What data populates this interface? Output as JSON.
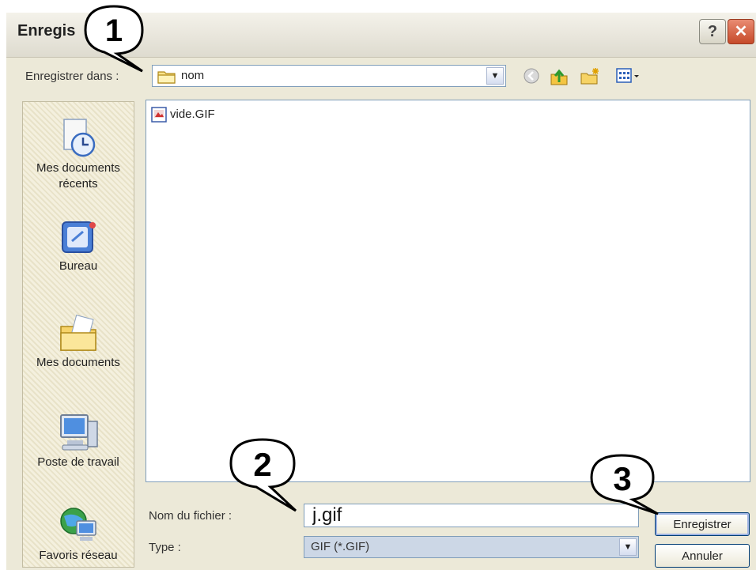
{
  "dialog": {
    "title": "Enregis",
    "help_glyph": "?",
    "close_glyph": "✕"
  },
  "toolbar": {
    "lookin_label": "Enregistrer dans :",
    "lookin_value": "nom",
    "icons": [
      "back-icon",
      "up-folder-icon",
      "new-folder-icon",
      "view-menu-icon"
    ]
  },
  "places": [
    {
      "label": "Mes documents récents",
      "icon": "recent-documents-icon"
    },
    {
      "label": "Bureau",
      "icon": "desktop-icon"
    },
    {
      "label": "Mes documents",
      "icon": "my-documents-icon"
    },
    {
      "label": "Poste de travail",
      "icon": "my-computer-icon"
    },
    {
      "label": "Favoris réseau",
      "icon": "network-places-icon"
    }
  ],
  "files": [
    {
      "name": "vide.GIF",
      "icon": "gif-file-icon"
    }
  ],
  "form": {
    "filename_label": "Nom du fichier :",
    "filename_value": "j.gif",
    "type_label": "Type :",
    "type_value": "GIF (*.GIF)",
    "save_label": "Enregistrer",
    "cancel_label": "Annuler"
  },
  "callouts": [
    "1",
    "2",
    "3"
  ],
  "colors": {
    "dialog_bg": "#ece9d8",
    "close_red": "#c64a2a",
    "field_border": "#7f9db9"
  }
}
